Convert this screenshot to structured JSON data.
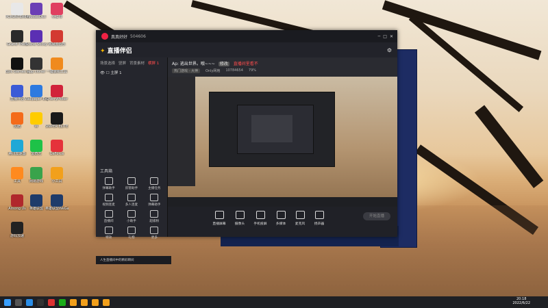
{
  "desktop": {
    "icons": [
      {
        "label": "PCHUNTER64",
        "color": "#e8e8e8"
      },
      {
        "label": "YoudaoDict",
        "color": "#6b3fb5"
      },
      {
        "label": "小红书",
        "color": "#e04060"
      },
      {
        "label": "Grand Theft",
        "color": "#2a2a2a"
      },
      {
        "label": "Scene Sticky",
        "color": "#5b2fb3"
      },
      {
        "label": "网易云音乐",
        "color": "#d33a31"
      },
      {
        "label": "Epic Games Launcher",
        "color": "#111111"
      },
      {
        "label": "app cloner",
        "color": "#333333"
      },
      {
        "label": "一键装机工具",
        "color": "#f08a1d"
      },
      {
        "label": "直播伴侣",
        "color": "#3b5bd6"
      },
      {
        "label": "Wallpaper Engine",
        "color": "#2d7ae0"
      },
      {
        "label": "CherryPicker",
        "color": "#d1223a"
      },
      {
        "label": "优酷",
        "color": "#f46b1a"
      },
      {
        "label": "W",
        "color": "#ffcc00"
      },
      {
        "label": "SNIPER ELITE 5",
        "color": "#1a1a1a"
      },
      {
        "label": "腾讯加速器",
        "color": "#1fa8d6"
      },
      {
        "label": "爱奇艺",
        "color": "#1ec248"
      },
      {
        "label": "GeForce",
        "color": "#e5323b"
      },
      {
        "label": "工具",
        "color": "#ff8a1f"
      },
      {
        "label": "网易游戏",
        "color": "#39a34b"
      },
      {
        "label": "小工具",
        "color": "#f2a01c"
      },
      {
        "label": "Among Us",
        "color": "#b0282c"
      },
      {
        "label": "英雄联盟",
        "color": "#1e3b6a"
      },
      {
        "label": "英雄联盟WeGame",
        "color": "#1e3b6a"
      },
      {
        "label": "游戏加速",
        "color": "#222222"
      }
    ]
  },
  "app": {
    "title_text": "直播伴侣",
    "user_name": "真真好好",
    "user_id": "504606",
    "brand": "直播伴侣",
    "left_tabs": [
      "场景选择",
      "竖屏",
      "背景素材",
      "横屏 1"
    ],
    "scene_item": "主屏 1",
    "tools_header": "工具箱",
    "tools": [
      {
        "label": "弹幕助手"
      },
      {
        "label": "房管助手"
      },
      {
        "label": "主播任务"
      },
      {
        "label": "视频连麦"
      },
      {
        "label": "多人连麦"
      },
      {
        "label": "弹幕助手"
      },
      {
        "label": "直播间"
      },
      {
        "label": "小助手"
      },
      {
        "label": "超级粉"
      },
      {
        "label": "特效"
      },
      {
        "label": "礼物"
      },
      {
        "label": "更多"
      }
    ],
    "bottom_note": "人生直播间中的精彩瞬间",
    "room_title": "Ap: 逃出世界。哦~~~",
    "room_tag": "修改",
    "room_red": "直播间里看不",
    "stats": {
      "tag": "热门游戏 - 大神",
      "a": "Only网格",
      "b": "10784654",
      "c": "79%"
    },
    "controls": [
      {
        "label": "直播屏幕"
      },
      {
        "label": "摄像头"
      },
      {
        "label": "手机投屏"
      },
      {
        "label": "多媒体"
      },
      {
        "label": "麦克风"
      },
      {
        "label": "扬声器"
      }
    ],
    "go_live": "开始直播"
  },
  "taskbar": {
    "time": "20:18",
    "date": "2022/6/22"
  }
}
